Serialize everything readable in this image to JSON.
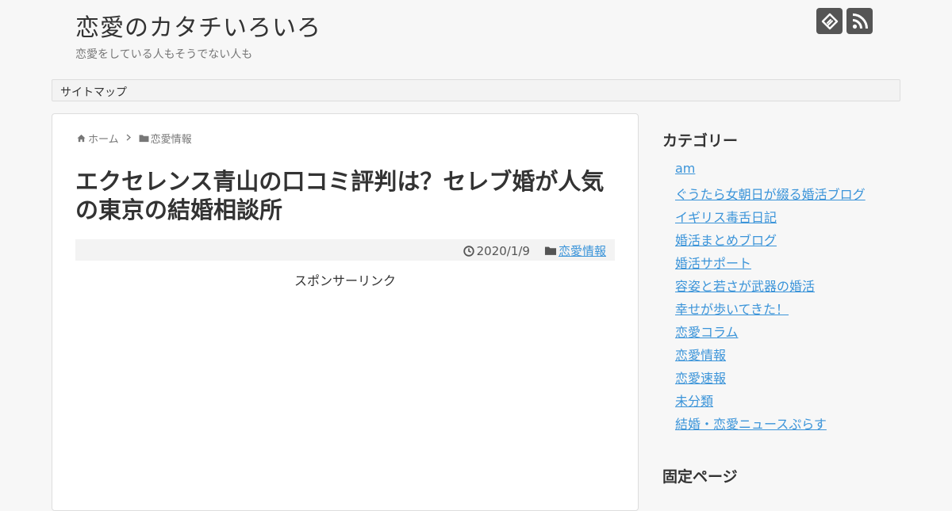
{
  "header": {
    "site_title": "恋愛のカタチいろいろ",
    "tagline": "恋愛をしている人もそうでない人も",
    "icons": [
      "feedly-icon",
      "rss-icon"
    ],
    "icon_color": "#555555"
  },
  "nav": {
    "items": [
      {
        "label": "サイトマップ"
      }
    ]
  },
  "breadcrumb": {
    "home_label": "ホーム",
    "category_label": "恋愛情報"
  },
  "article": {
    "title": "エクセレンス青山の口コミ評判は？セレブ婚が人気の東京の結婚相談所",
    "date": "2020/1/9",
    "category": "恋愛情報",
    "sponsor_label": "スポンサーリンク"
  },
  "sidebar": {
    "categories_title": "カテゴリー",
    "categories": [
      "am",
      "ぐうたら女朝日が綴る婚活ブログ",
      "イギリス毒舌日記",
      "婚活まとめブログ",
      "婚活サポート",
      "容姿と若さが武器の婚活",
      "幸せが歩いてきた！",
      "恋愛コラム",
      "恋愛情報",
      "恋愛速報",
      "未分類",
      "結婚・恋愛ニュースぷらす"
    ],
    "pages_title": "固定ページ",
    "link_color": "#3b94d9"
  }
}
